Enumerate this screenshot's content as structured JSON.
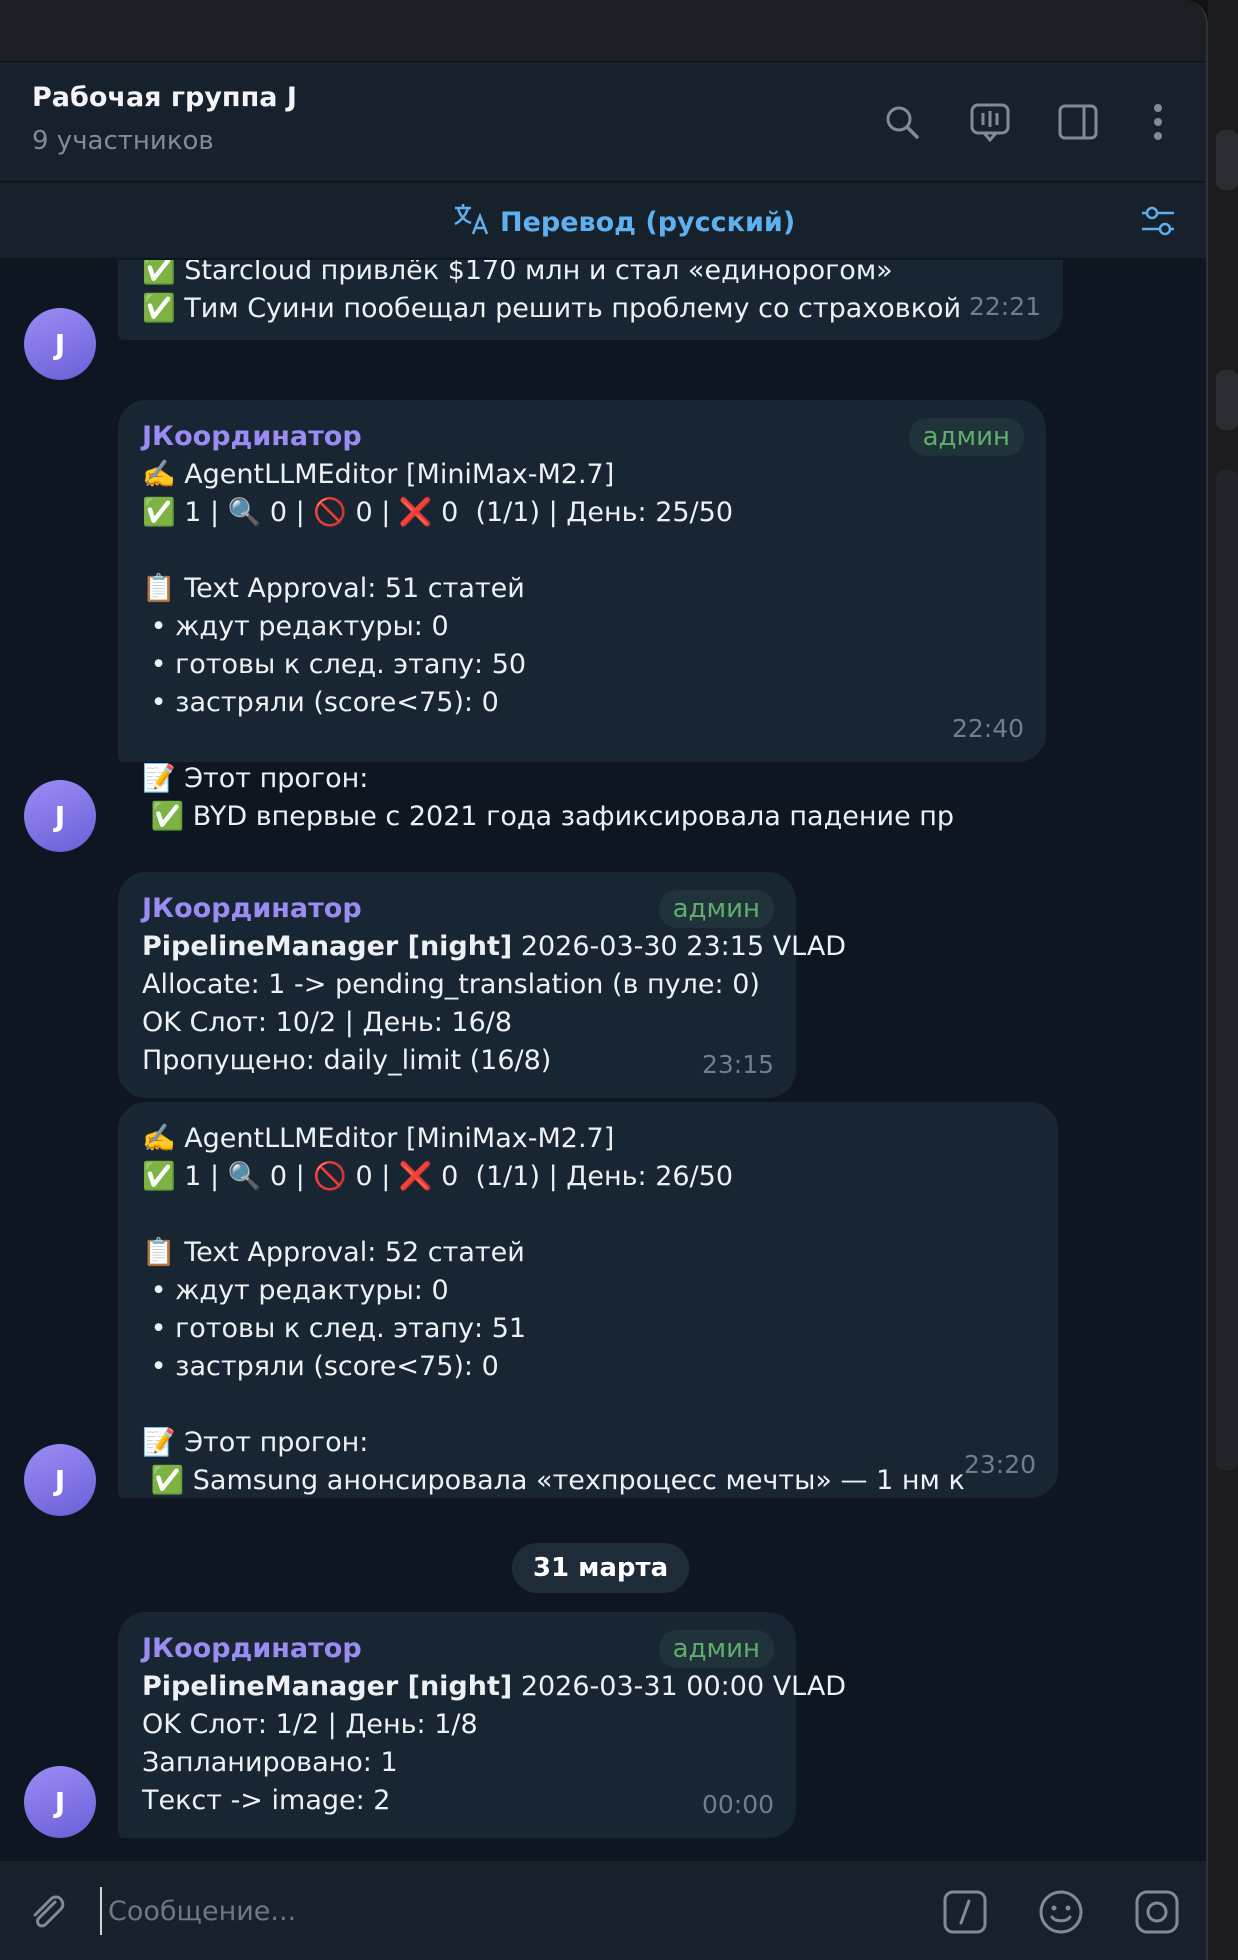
{
  "header": {
    "title": "Рабочая группа J",
    "subtitle": "9 участников"
  },
  "translate": {
    "label": "Перевод (русский)"
  },
  "messages": [
    {
      "sender": "",
      "admin_badge": "",
      "lines": [
        "✅ Starcloud привлёк $170 млн и стал «единорогом»",
        "✅ Тим Суини пообещал решить проблему со страховкой"
      ],
      "time": "22:21"
    },
    {
      "sender": "JКоординатор",
      "admin_badge": "админ",
      "lines": [
        "✍️ AgentLLMEditor [MiniMax-M2.7]",
        "✅ 1 | 🔍 0 | 🚫 0 | ❌ 0  (1/1) | День: 25/50",
        "",
        "📋 Text Approval: 51 статей",
        " • ждут редактуры: 0",
        " • готовы к след. этапу: 50",
        " • застряли (score<75): 0",
        "",
        "📝 Этот прогон:",
        " ✅ BYD впервые с 2021 года зафиксировала падение пр"
      ],
      "time": "22:40"
    },
    {
      "sender": "JКоординатор",
      "admin_badge": "админ",
      "bold_prefix": "PipelineManager [night]",
      "lines": [
        " 2026-03-30 23:15 VLAD",
        "Allocate: 1 -> pending_translation (в пуле: 0)",
        "OK Слот: 10/2 | День: 16/8",
        "Пропущено: daily_limit (16/8)"
      ],
      "time": "23:15"
    },
    {
      "sender": "",
      "admin_badge": "",
      "lines": [
        "✍️ AgentLLMEditor [MiniMax-M2.7]",
        "✅ 1 | 🔍 0 | 🚫 0 | ❌ 0  (1/1) | День: 26/50",
        "",
        "📋 Text Approval: 52 статей",
        " • ждут редактуры: 0",
        " • готовы к след. этапу: 51",
        " • застряли (score<75): 0",
        "",
        "📝 Этот прогон:",
        " ✅ Samsung анонсировала «техпроцесс мечты» — 1 нм к"
      ],
      "time": "23:20"
    },
    {
      "sender": "JКоординатор",
      "admin_badge": "админ",
      "bold_prefix": "PipelineManager [night]",
      "lines": [
        " 2026-03-31 00:00 VLAD",
        "OK Слот: 1/2 | День: 1/8",
        "Запланировано: 1",
        "Текст -> image: 2"
      ],
      "time": "00:00"
    }
  ],
  "date_separator": "31 марта",
  "avatar_letter": "J",
  "composer": {
    "placeholder": "Сообщение..."
  },
  "icons": [
    "search-icon",
    "livestream-icon",
    "sidebar-toggle-icon",
    "more-vertical-icon",
    "translate-icon",
    "filter-settings-icon",
    "attach-icon",
    "commands-icon",
    "emoji-icon",
    "camera-icon"
  ],
  "colors": {
    "background": "#0e1621",
    "bubble": "#182533",
    "sender": "#9a8cf2",
    "admin_badge": "#5fae6a",
    "accent": "#5eb0ef"
  }
}
